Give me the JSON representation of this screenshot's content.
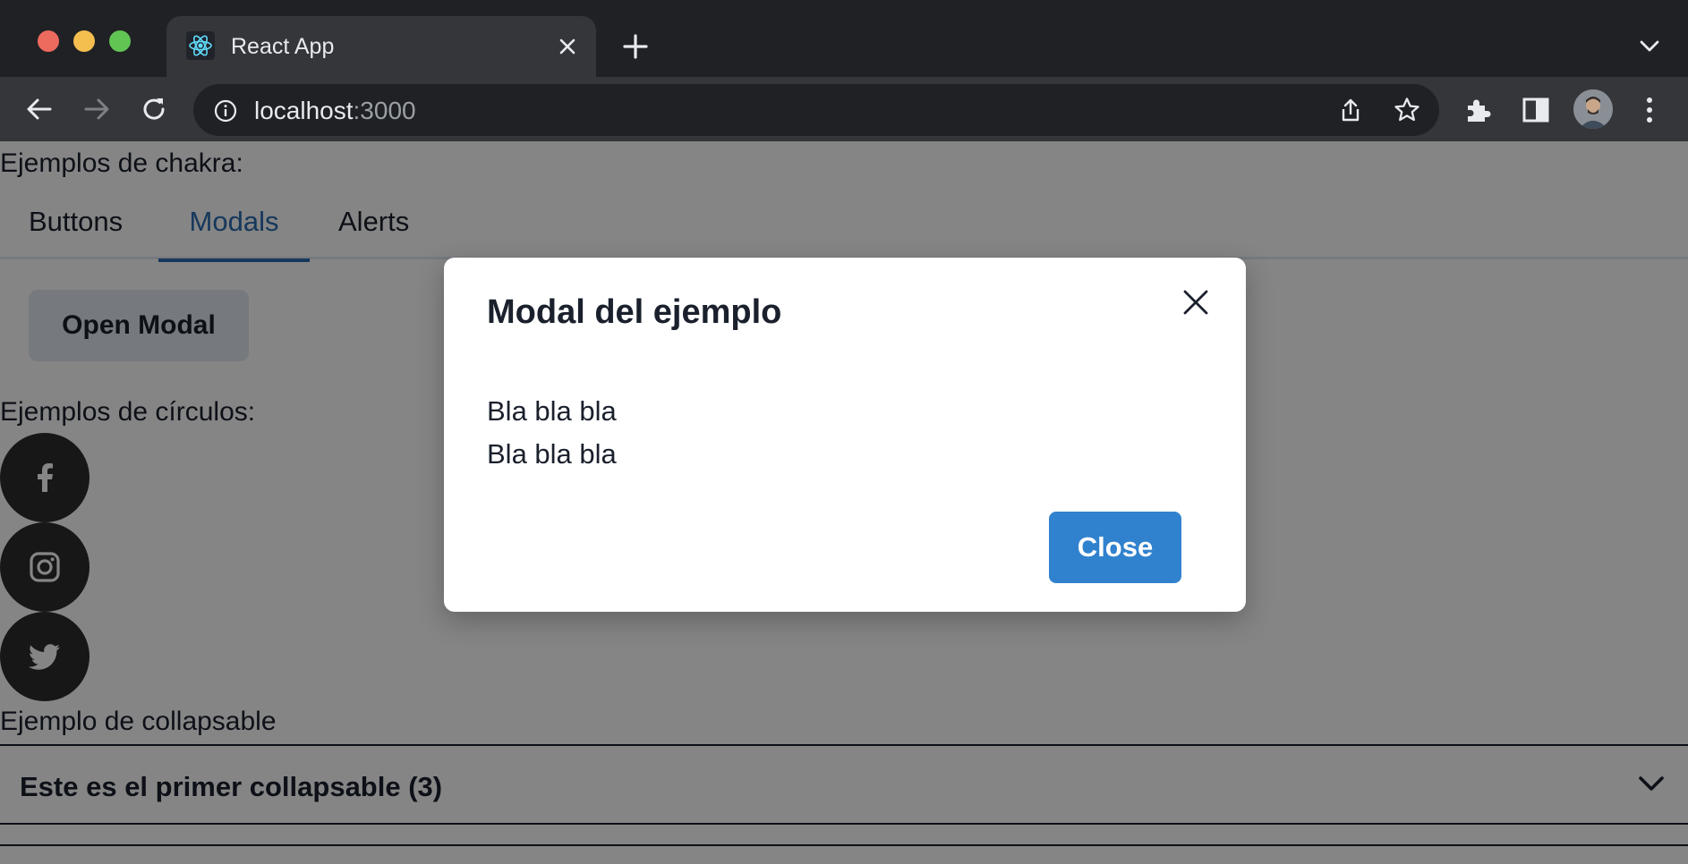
{
  "browser": {
    "tab_title": "React App",
    "url_host": "localhost",
    "url_port": ":3000",
    "icons": [
      "react-favicon",
      "close-icon",
      "plus-icon",
      "chevron-down-icon",
      "back-icon",
      "forward-icon",
      "reload-icon",
      "info-icon",
      "share-icon",
      "star-icon",
      "puzzle-icon",
      "side-panel-icon",
      "avatar",
      "kebab-icon"
    ]
  },
  "page": {
    "chakra_heading": "Ejemplos de chakra:",
    "tabs": [
      {
        "label": "Buttons"
      },
      {
        "label": "Modals",
        "active": true
      },
      {
        "label": "Alerts"
      }
    ],
    "open_modal_label": "Open Modal",
    "circles_heading": "Ejemplos de círculos:",
    "circles": [
      "facebook-icon",
      "instagram-icon",
      "twitter-icon"
    ],
    "collapsable_heading": "Ejemplo de collapsable",
    "collapsables": [
      {
        "title": "Este es el primer collapsable (3)"
      },
      {
        "title": ""
      }
    ]
  },
  "modal": {
    "title": "Modal del ejemplo",
    "body": [
      "Bla bla bla",
      "Bla bla bla"
    ],
    "close_label": "Close"
  },
  "colors": {
    "accent": "#2b6cb0",
    "primary_button": "#3182ce",
    "chrome_bg": "#202124",
    "toolbar_bg": "#35363a"
  }
}
